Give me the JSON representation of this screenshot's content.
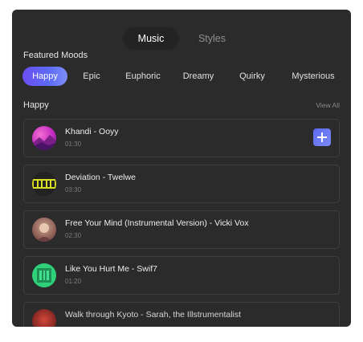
{
  "tabs": [
    {
      "label": "Music",
      "active": true
    },
    {
      "label": "Styles",
      "active": false
    }
  ],
  "featured": {
    "title": "Featured Moods",
    "chips": [
      {
        "label": "Happy",
        "active": true
      },
      {
        "label": "Epic",
        "active": false
      },
      {
        "label": "Euphoric",
        "active": false
      },
      {
        "label": "Dreamy",
        "active": false
      },
      {
        "label": "Quirky",
        "active": false
      },
      {
        "label": "Mysterious",
        "active": false
      }
    ]
  },
  "list": {
    "title": "Happy",
    "view_all": "View All",
    "tracks": [
      {
        "title": "Khandi - Ooyy",
        "duration": "01:30"
      },
      {
        "title": "Deviation - Twelwe",
        "duration": "03:30"
      },
      {
        "title": "Free Your Mind (Instrumental Version) - Vicki Vox",
        "duration": "02:30"
      },
      {
        "title": "Like You Hurt Me - Swif7",
        "duration": "01:20"
      },
      {
        "title": "Walk through Kyoto - Sarah, the Illstrumentalist",
        "duration": ""
      }
    ]
  },
  "colors": {
    "panel": "#2b2b2b",
    "accent": "#6d4df2",
    "add_button": "#5d6bf0"
  },
  "icons": {
    "add": "plus-icon"
  }
}
